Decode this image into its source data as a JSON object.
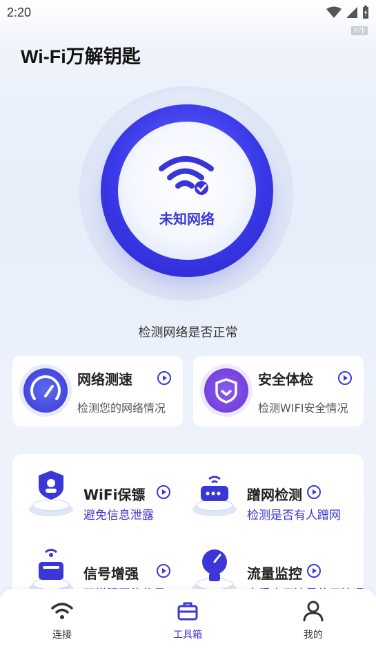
{
  "status_bar": {
    "time": "2:20",
    "badge": "87|l"
  },
  "app": {
    "title": "Wi-Fi万解钥匙"
  },
  "hero": {
    "network_label": "未知网络",
    "check_text": "检测网络是否正常"
  },
  "cards": [
    {
      "title": "网络测速",
      "desc": "检测您的网络情况"
    },
    {
      "title": "安全体检",
      "desc": "检测WIFI安全情况"
    }
  ],
  "tools": [
    {
      "title": "WiFi保镖",
      "desc": "避免信息泄露"
    },
    {
      "title": "蹭网检测",
      "desc": "检测是否有人蹭网"
    },
    {
      "title": "信号增强",
      "desc": "可增强网络信号"
    },
    {
      "title": "流量监控",
      "desc": "查看应用流量使用情况"
    }
  ],
  "nav": [
    {
      "label": "连接",
      "icon": "wifi-icon"
    },
    {
      "label": "工具箱",
      "icon": "toolbox-icon",
      "active": true
    },
    {
      "label": "我的",
      "icon": "user-icon"
    }
  ],
  "colors": {
    "accent": "#3b37d6",
    "disc": "#3a39e8",
    "card_bg": "#ffffff"
  }
}
